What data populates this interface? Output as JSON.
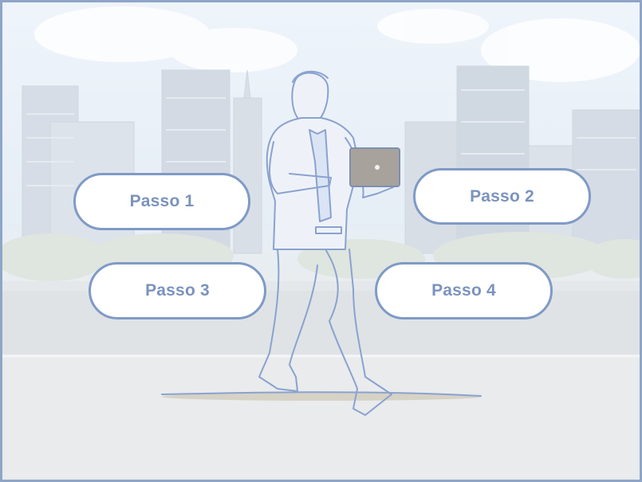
{
  "steps": [
    {
      "label": "Passo 1"
    },
    {
      "label": "Passo 2"
    },
    {
      "label": "Passo 3"
    },
    {
      "label": "Passo 4"
    }
  ],
  "colors": {
    "button_border": "#7f9ac6",
    "button_text": "#7b93bd",
    "button_fill": "#ffffff",
    "frame_border": "#8fa5c8",
    "sketch_line": "#8aa2cf"
  },
  "background": {
    "icon": "city-skyline-illustration",
    "figure": "walking-man-with-laptop-sketch"
  }
}
